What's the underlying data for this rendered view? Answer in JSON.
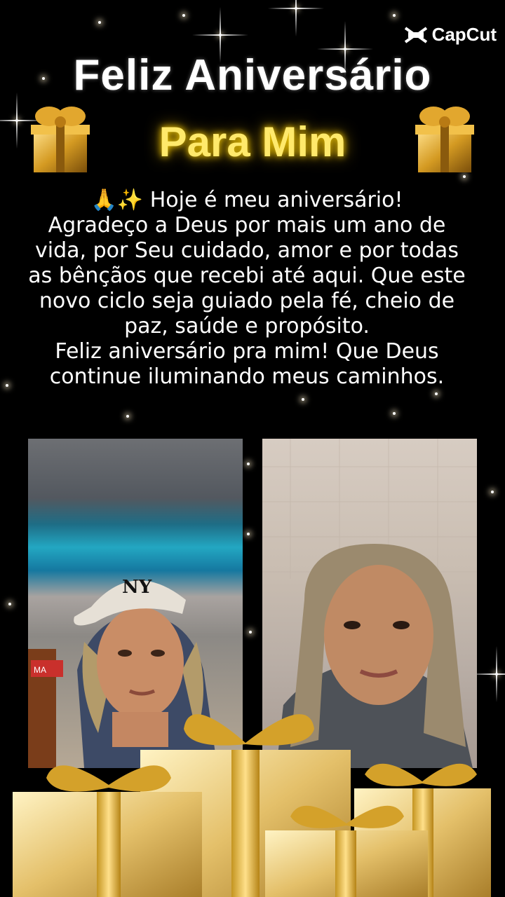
{
  "watermark": {
    "brand": "CapCut",
    "icon": "capcut-logo-icon"
  },
  "header": {
    "title": "Feliz Aniversário",
    "subtitle": "Para Mim"
  },
  "message": {
    "lines": [
      "🙏✨ Hoje é meu aniversário!",
      "Agradeço a Deus por mais um ano de",
      "vida, por Seu cuidado, amor e por todas",
      "as bênçãos que recebi até aqui. Que este",
      "novo ciclo seja guiado pela fé, cheio de",
      "paz, saúde e propósito.",
      "Feliz aniversário pra mim! Que Deus",
      "continue iluminando meus caminhos."
    ]
  },
  "photos": {
    "left": {
      "cap_text": "NY",
      "sign_text": "MA"
    },
    "right": {}
  },
  "colors": {
    "background": "#000000",
    "title": "#ffffff",
    "subtitle_glow": "#ffd400",
    "gold": "#e8c25a"
  }
}
